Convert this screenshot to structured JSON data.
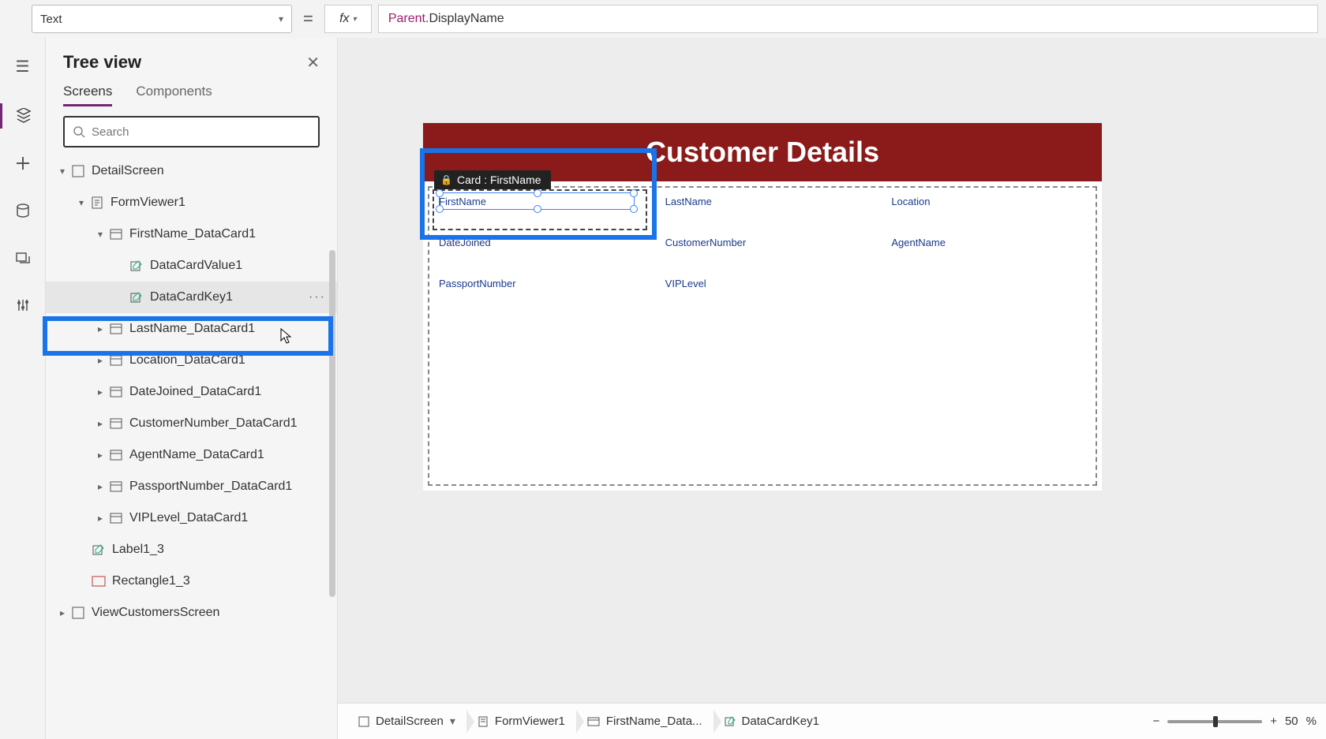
{
  "property_dropdown": {
    "label": "Text"
  },
  "formula": {
    "parent": "Parent",
    "rest": ".DisplayName"
  },
  "tree": {
    "title": "Tree view",
    "tabs": {
      "screens": "Screens",
      "components": "Components"
    },
    "search_placeholder": "Search",
    "nodes": {
      "detail_screen": "DetailScreen",
      "form_viewer": "FormViewer1",
      "firstname_card": "FirstName_DataCard1",
      "datacard_value": "DataCardValue1",
      "datacard_key": "DataCardKey1",
      "lastname_card": "LastName_DataCard1",
      "location_card": "Location_DataCard1",
      "datejoined_card": "DateJoined_DataCard1",
      "customernum_card": "CustomerNumber_DataCard1",
      "agentname_card": "AgentName_DataCard1",
      "passport_card": "PassportNumber_DataCard1",
      "viplevel_card": "VIPLevel_DataCard1",
      "label1_3": "Label1_3",
      "rectangle1_3": "Rectangle1_3",
      "viewcustomers": "ViewCustomersScreen"
    }
  },
  "canvas": {
    "header": "Customer Details",
    "card_tag": "Card : FirstName",
    "fields": {
      "firstname": "FirstName",
      "lastname": "LastName",
      "location": "Location",
      "datejoined": "DateJoined",
      "customernumber": "CustomerNumber",
      "agentname": "AgentName",
      "passportnumber": "PassportNumber",
      "viplevel": "VIPLevel"
    }
  },
  "breadcrumb": {
    "detail": "DetailScreen",
    "form": "FormViewer1",
    "card": "FirstName_Data...",
    "key": "DataCardKey1"
  },
  "zoom": {
    "value": "50",
    "pct": "%"
  }
}
